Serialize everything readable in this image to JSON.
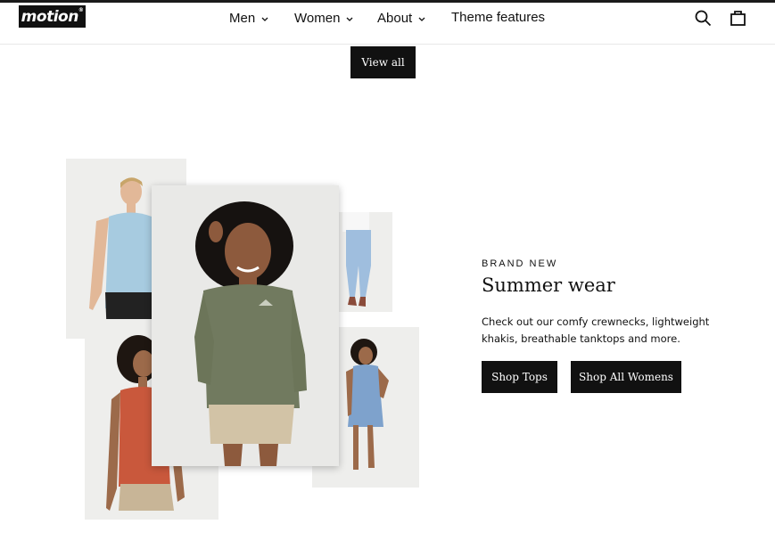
{
  "brand": {
    "logo_text": "motion",
    "logo_mark": "®"
  },
  "nav": {
    "items": [
      {
        "label": "Men",
        "has_dropdown": true
      },
      {
        "label": "Women",
        "has_dropdown": true
      },
      {
        "label": "About",
        "has_dropdown": true
      },
      {
        "label": "Theme features",
        "has_dropdown": false
      }
    ]
  },
  "header_icons": {
    "search": "search-icon",
    "cart": "cart-icon"
  },
  "collection": {
    "view_all_label": "View all"
  },
  "promo": {
    "eyebrow": "BRAND NEW",
    "title": "Summer wear",
    "description": "Check out our comfy crewnecks, lightweight khakis, breathable tanktops and more.",
    "buttons": [
      {
        "label": "Shop Tops"
      },
      {
        "label": "Shop All Womens"
      }
    ]
  },
  "colors": {
    "accent": "#111111",
    "background": "#ffffff",
    "photo_background": "#ebebea"
  }
}
